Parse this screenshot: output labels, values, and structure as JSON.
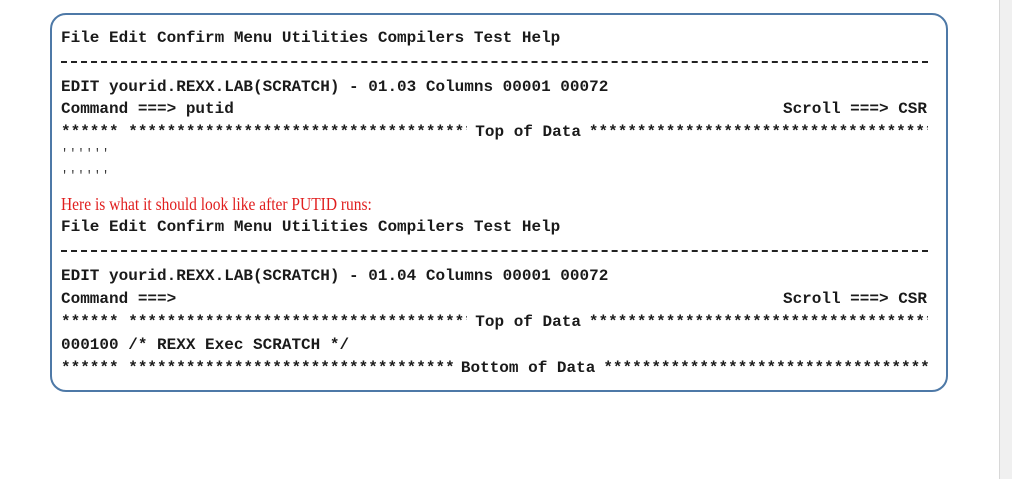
{
  "before": {
    "menu_bar": "File Edit Confirm Menu Utilities Compilers Test Help",
    "edit_title": "EDIT yourid.REXX.LAB(SCRATCH) - 01.03 Columns 00001 00072",
    "command_line": "Command ===> putid",
    "scroll": "Scroll ===> CSR",
    "top_marker": "******",
    "top_label": "Top of Data",
    "blank_line_1": "''''''",
    "blank_line_2": "''''''"
  },
  "note": "Here is what it should look like after PUTID runs:",
  "after": {
    "menu_bar": "File Edit Confirm Menu Utilities Compilers Test Help",
    "edit_title": "EDIT yourid.REXX.LAB(SCRATCH) - 01.04 Columns 00001 00072",
    "command_line": "Command ===>",
    "scroll": "Scroll ===> CSR",
    "top_marker": "******",
    "top_label": "Top of Data",
    "data_line": "000100 /* REXX Exec SCRATCH */",
    "bottom_marker": "******",
    "bottom_label": "Bottom of Data"
  },
  "stars_fill": "****************************************************************************************************",
  "colors": {
    "border": "#4e79a7",
    "note_red": "#e01e1e",
    "text": "#1a1a1a"
  }
}
